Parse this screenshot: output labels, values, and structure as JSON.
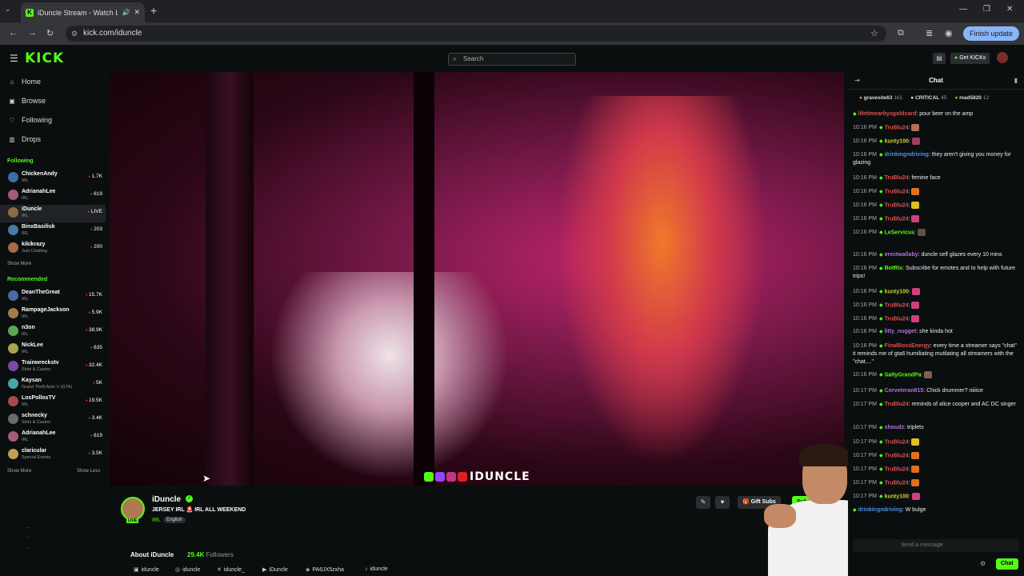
{
  "browser": {
    "tab_title": "iDuncle Stream - Watch Live",
    "new_tab": "+",
    "url": "kick.com/iduncle",
    "finish_update": "Finish update"
  },
  "kick": {
    "logo": "KICK",
    "search_placeholder": "Search",
    "get_kicks": "Get KICKs"
  },
  "sidebar": {
    "nav": [
      {
        "label": "Home",
        "icon": "home-icon"
      },
      {
        "label": "Browse",
        "icon": "browse-icon"
      },
      {
        "label": "Following",
        "icon": "heart-icon"
      },
      {
        "label": "Drops",
        "icon": "drops-icon"
      }
    ],
    "following_header": "Following",
    "following": [
      {
        "name": "ChickenAndy",
        "category": "IRL",
        "viewers": "1.7K",
        "color": "#3a6ea5"
      },
      {
        "name": "AdrianahLee",
        "category": "IRL",
        "viewers": "619",
        "color": "#a55a7a"
      },
      {
        "name": "iDuncle",
        "category": "IRL",
        "viewers": "LIVE",
        "color": "#8a6a4a"
      },
      {
        "name": "BinxBasilisk",
        "category": "IRL",
        "viewers": "203",
        "color": "#4a7aa5"
      },
      {
        "name": "kikikrazy",
        "category": "Just Chatting",
        "viewers": "200",
        "color": "#a56a4a"
      }
    ],
    "show_more_1": "Show More",
    "recommended_header": "Recommended",
    "recommended": [
      {
        "name": "DeanTheGreat",
        "category": "IRL",
        "viewers": "15.7K",
        "color": "#4a6aa5"
      },
      {
        "name": "RampageJackson",
        "category": "IRL",
        "viewers": "5.9K",
        "color": "#a57a4a"
      },
      {
        "name": "n3on",
        "category": "IRL",
        "viewers": "38.9K",
        "color": "#5aa55a"
      },
      {
        "name": "NickLee",
        "category": "IRL",
        "viewers": "635",
        "color": "#a5a54a"
      },
      {
        "name": "Trainwreckstv",
        "category": "Slots & Casino",
        "viewers": "32.4K",
        "color": "#7a4aa5"
      },
      {
        "name": "Kaysan",
        "category": "Grand Theft Auto V (GTA)",
        "viewers": "5K",
        "color": "#4aa5a5"
      },
      {
        "name": "LosPollosTV",
        "category": "IRL",
        "viewers": "19.5K",
        "color": "#a54a4a"
      },
      {
        "name": "schnecky",
        "category": "Slots & Casino",
        "viewers": "3.4K",
        "color": "#6a6a6a"
      },
      {
        "name": "AdrianahLee",
        "category": "IRL",
        "viewers": "619",
        "color": "#a55a7a"
      },
      {
        "name": "claricular",
        "category": "Special Events",
        "viewers": "3.5K",
        "color": "#c0a050"
      }
    ],
    "show_more_2": "Show More",
    "show_less": "Show Less",
    "bottom_1": "..",
    "bottom_2": "..",
    "bottom_3": ".."
  },
  "video": {
    "watermark": "IDUNCLE"
  },
  "streamer": {
    "name": "iDuncle",
    "live_badge": "LIVE",
    "title": "JERSEY IRL 🚨 IRL ALL WEEKEND",
    "category": "IRL",
    "language": "English",
    "gift_subs": "🎁 Gift Subs",
    "subscribe": "Subscribe",
    "about_label": "About iDuncle",
    "followers_count": "29.4K",
    "followers_label": "Followers",
    "socials": [
      {
        "icon": "kick-icon",
        "label": "iduncle"
      },
      {
        "icon": "instagram-icon",
        "label": "iduncle"
      },
      {
        "icon": "x-icon",
        "label": "iduncle_"
      },
      {
        "icon": "youtube-icon",
        "label": "iDuncle"
      },
      {
        "icon": "discord-icon",
        "label": "PA6JX5zxha"
      },
      {
        "icon": "tiktok-icon",
        "label": "iduncle"
      }
    ]
  },
  "chat": {
    "title": "Chat",
    "leaders": [
      {
        "name": "gravesite63",
        "count": "161"
      },
      {
        "name": "CRITICAL",
        "count": "45"
      },
      {
        "name": "mad5820",
        "count": "12"
      }
    ],
    "messages": [
      {
        "time": "",
        "user": "lifetimearbysgoldcard",
        "color": "#e05050",
        "text": "pour beer on the amp",
        "emote": ""
      },
      {
        "time": "10:16 PM",
        "user": "TruBlu24",
        "color": "#e05050",
        "text": "",
        "emote": "#b07050"
      },
      {
        "time": "10:16 PM",
        "user": "kunty100",
        "color": "#d0d030",
        "text": "",
        "emote": "#a04060"
      },
      {
        "time": "10:16 PM",
        "user": "drinkingndriving",
        "color": "#4a90e2",
        "text": "they aren't giving you money for glazing",
        "emote": ""
      },
      {
        "time": "10:16 PM",
        "user": "TruBlu24",
        "color": "#e05050",
        "text": "femine face",
        "emote": ""
      },
      {
        "time": "10:16 PM",
        "user": "TruBlu24",
        "color": "#e05050",
        "text": "",
        "emote": "#e07020"
      },
      {
        "time": "10:16 PM",
        "user": "TruBlu24",
        "color": "#e05050",
        "text": "",
        "emote": "#e0c020"
      },
      {
        "time": "10:16 PM",
        "user": "TruBlu24",
        "color": "#e05050",
        "text": "",
        "emote": "#d04080"
      },
      {
        "time": "10:16 PM",
        "user": "LeServicus",
        "color": "#53fc18",
        "text": "",
        "emote": "#605040"
      },
      {
        "time": "10:16 PM",
        "user": "erectwallaby",
        "color": "#b070e0",
        "text": "duncle self glazes every 10 mins",
        "emote": ""
      },
      {
        "time": "10:16 PM",
        "user": "BotRix",
        "color": "#53fc18",
        "text": "Subscribe for emotes and to help with future trips!",
        "emote": ""
      },
      {
        "time": "10:16 PM",
        "user": "kunty100",
        "color": "#d0d030",
        "text": "",
        "emote": "#d04080"
      },
      {
        "time": "10:16 PM",
        "user": "TruBlu24",
        "color": "#e05050",
        "text": "",
        "emote": "#d04080"
      },
      {
        "time": "10:16 PM",
        "user": "TruBlu24",
        "color": "#e05050",
        "text": "",
        "emote": "#d04080"
      },
      {
        "time": "10:16 PM",
        "user": "litty_nugget",
        "color": "#b070e0",
        "text": "she kinda hot",
        "emote": ""
      },
      {
        "time": "10:16 PM",
        "user": "FinalBossEnergy",
        "color": "#e05050",
        "text": "every time a streamer says \"chat\" it reminds me of gta6 humiliating mutilating all streamers with the \"chat....\"",
        "emote": ""
      },
      {
        "time": "10:16 PM",
        "user": "SaltyGrandPa",
        "color": "#53fc18",
        "text": "",
        "emote": "#806050"
      },
      {
        "time": "10:17 PM",
        "user": "Corveteran815",
        "color": "#b070e0",
        "text": "Chick drummer? niiiice",
        "emote": ""
      },
      {
        "time": "10:17 PM",
        "user": "TruBlu24",
        "color": "#e05050",
        "text": "reminds of alice cooper and AC DC singer",
        "emote": ""
      },
      {
        "time": "10:17 PM",
        "user": "shoudz",
        "color": "#b070e0",
        "text": "triplets",
        "emote": ""
      },
      {
        "time": "10:17 PM",
        "user": "TruBlu24",
        "color": "#e05050",
        "text": "",
        "emote": "#e0c020"
      },
      {
        "time": "10:17 PM",
        "user": "TruBlu24",
        "color": "#e05050",
        "text": "",
        "emote": "#e07020"
      },
      {
        "time": "10:17 PM",
        "user": "TruBlu24",
        "color": "#e05050",
        "text": "",
        "emote": "#e07020"
      },
      {
        "time": "10:17 PM",
        "user": "TruBlu24",
        "color": "#e05050",
        "text": "",
        "emote": "#e07020"
      },
      {
        "time": "10:17 PM",
        "user": "kunty100",
        "color": "#d0d030",
        "text": "",
        "emote": "#d04080"
      },
      {
        "time": "",
        "user": "drinkingndriving",
        "color": "#4a90e2",
        "text": "W bulge",
        "emote": ""
      }
    ],
    "input_placeholder": "Send a message",
    "send": "Chat"
  }
}
